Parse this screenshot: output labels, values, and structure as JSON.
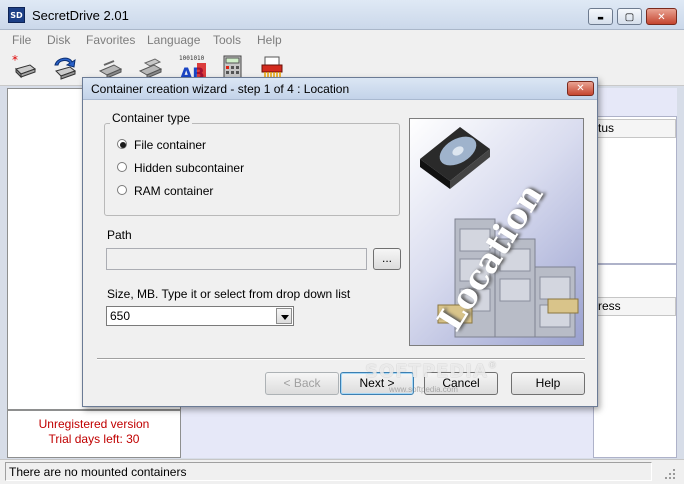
{
  "window": {
    "title": "SecretDrive 2.01",
    "icon_text": "SD",
    "controls": {
      "minimize": "▬",
      "maximize": "▢",
      "close": "✕"
    }
  },
  "menu": [
    "File",
    "Disk",
    "Favorites",
    "Language",
    "Tools",
    "Help"
  ],
  "toolbar": {
    "icons": [
      "new-container-icon",
      "mount-icon",
      "unmount-icon",
      "unmount-all-icon",
      "encrypt-text-icon",
      "calculator-icon",
      "shredder-icon"
    ],
    "encrypt_glyph": "AB",
    "encrypt_bits": "1001010"
  },
  "right_panels": {
    "top_column_fragment": "tus",
    "bottom_column_fragment": "ress"
  },
  "left_panel": {
    "unregistered": "Unregistered version",
    "trial": "Trial days left: 30"
  },
  "statusbar": {
    "text": "There are no mounted containers"
  },
  "dialog": {
    "title": "Container creation wizard - step 1 of 4 : Location",
    "close": "✕",
    "container_type": {
      "legend": "Container type",
      "options": [
        {
          "label": "File container",
          "selected": true
        },
        {
          "label": "Hidden subcontainer",
          "selected": false
        },
        {
          "label": "RAM container",
          "selected": false
        }
      ]
    },
    "path": {
      "label": "Path",
      "value": "",
      "browse": "..."
    },
    "size": {
      "label": "Size, MB. Type it or select from drop down list",
      "value": "650"
    },
    "artwork": {
      "caption": "Location"
    },
    "buttons": {
      "back": "< Back",
      "next": "Next >",
      "cancel": "Cancel",
      "help": "Help"
    }
  },
  "watermark": {
    "main": "SOFTPEDIA",
    "sub": "www.softpedia.com",
    "mark": "®"
  },
  "colors": {
    "trial_text": "#c00000",
    "titlebar": "#cbd8ea",
    "content_bg": "#e6e8f8"
  }
}
